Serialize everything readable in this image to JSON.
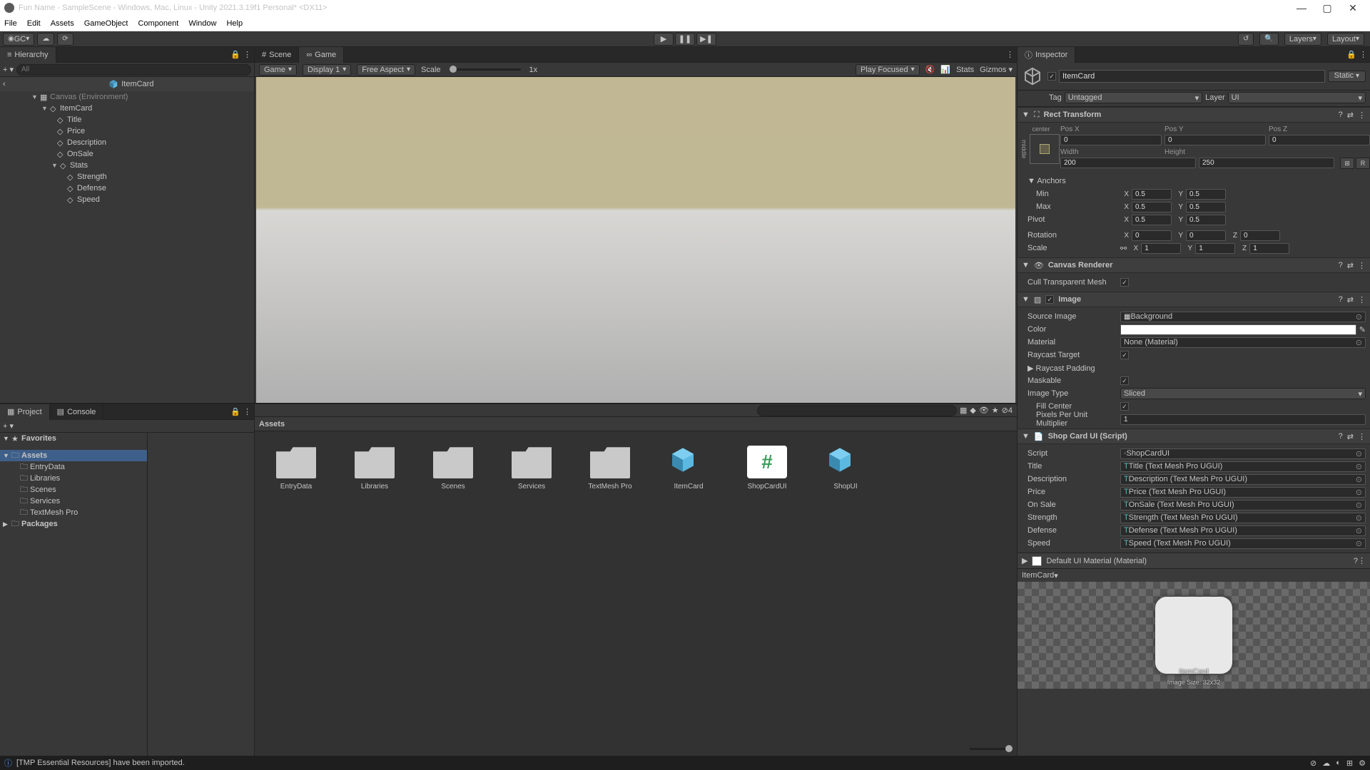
{
  "window": {
    "title": "Fun Name - SampleScene - Windows, Mac, Linux - Unity 2021.3.19f1 Personal* <DX11>"
  },
  "menubar": [
    "File",
    "Edit",
    "Assets",
    "GameObject",
    "Component",
    "Window",
    "Help"
  ],
  "toolbar": {
    "gc": "GC",
    "layers": "Layers",
    "layout": "Layout"
  },
  "hierarchy": {
    "tab": "Hierarchy",
    "search_placeholder": "All",
    "scene": "ItemCard",
    "tree": {
      "canvas": "Canvas (Environment)",
      "itemcard": "ItemCard",
      "title": "Title",
      "price": "Price",
      "description": "Description",
      "onsale": "OnSale",
      "stats": "Stats",
      "strength": "Strength",
      "defense": "Defense",
      "speed": "Speed"
    }
  },
  "game": {
    "scene_tab": "Scene",
    "game_tab": "Game",
    "game_dd": "Game",
    "display": "Display 1",
    "aspect": "Free Aspect",
    "scale_label": "Scale",
    "scale_val": "1x",
    "play_focused": "Play Focused",
    "stats": "Stats",
    "gizmos": "Gizmos"
  },
  "project": {
    "project_tab": "Project",
    "console_tab": "Console",
    "favorites": "Favorites",
    "assets_label": "Assets",
    "entrydata": "EntryData",
    "libraries": "Libraries",
    "scenes": "Scenes",
    "services": "Services",
    "tmpro": "TextMesh Pro",
    "packages": "Packages",
    "grid_header": "Assets",
    "items": {
      "entrydata": "EntryData",
      "libraries": "Libraries",
      "scenes": "Scenes",
      "services": "Services",
      "tmpro": "TextMesh Pro",
      "itemcard": "ItemCard",
      "shopcardui": "ShopCardUI",
      "shopui": "ShopUI"
    }
  },
  "inspector": {
    "tab": "Inspector",
    "name": "ItemCard",
    "static": "Static",
    "tag_label": "Tag",
    "tag_val": "Untagged",
    "layer_label": "Layer",
    "layer_val": "UI",
    "rect": {
      "title": "Rect Transform",
      "center": "center",
      "middle": "middle",
      "posx_l": "Pos X",
      "posy_l": "Pos Y",
      "posz_l": "Pos Z",
      "posx": "0",
      "posy": "0",
      "posz": "0",
      "w_l": "Width",
      "h_l": "Height",
      "w": "200",
      "h": "250",
      "anchors": "Anchors",
      "min": "Min",
      "max": "Max",
      "minx": "0.5",
      "miny": "0.5",
      "maxx": "0.5",
      "maxy": "0.5",
      "pivot": "Pivot",
      "pivx": "0.5",
      "pivy": "0.5",
      "rotation": "Rotation",
      "rx": "0",
      "ry": "0",
      "rz": "0",
      "scale": "Scale",
      "sx": "1",
      "sy": "1",
      "sz": "1"
    },
    "canvas_renderer": {
      "title": "Canvas Renderer",
      "cull": "Cull Transparent Mesh"
    },
    "image": {
      "title": "Image",
      "source_l": "Source Image",
      "source": "Background",
      "color_l": "Color",
      "material_l": "Material",
      "material": "None (Material)",
      "raycast_l": "Raycast Target",
      "raypad_l": "Raycast Padding",
      "maskable_l": "Maskable",
      "imgtype_l": "Image Type",
      "imgtype": "Sliced",
      "fillcenter_l": "Fill Center",
      "ppu_l": "Pixels Per Unit Multiplier",
      "ppu": "1"
    },
    "script": {
      "title": "Shop Card UI (Script)",
      "script_l": "Script",
      "script": "ShopCardUI",
      "title_l": "Title",
      "title_v": "Title (Text Mesh Pro UGUI)",
      "desc_l": "Description",
      "desc_v": "Description (Text Mesh Pro UGUI)",
      "price_l": "Price",
      "price_v": "Price (Text Mesh Pro UGUI)",
      "onsale_l": "On Sale",
      "onsale_v": "OnSale (Text Mesh Pro UGUI)",
      "strength_l": "Strength",
      "strength_v": "Strength (Text Mesh Pro UGUI)",
      "defense_l": "Defense",
      "defense_v": "Defense (Text Mesh Pro UGUI)",
      "speed_l": "Speed",
      "speed_v": "Speed (Text Mesh Pro UGUI)"
    },
    "material": "Default UI Material (Material)",
    "preview_name": "ItemCard",
    "preview_footer": "ItemCard",
    "preview_size": "Image Size: 32x32"
  },
  "status": {
    "msg": "[TMP Essential Resources] have been imported.",
    "aa": "4"
  }
}
